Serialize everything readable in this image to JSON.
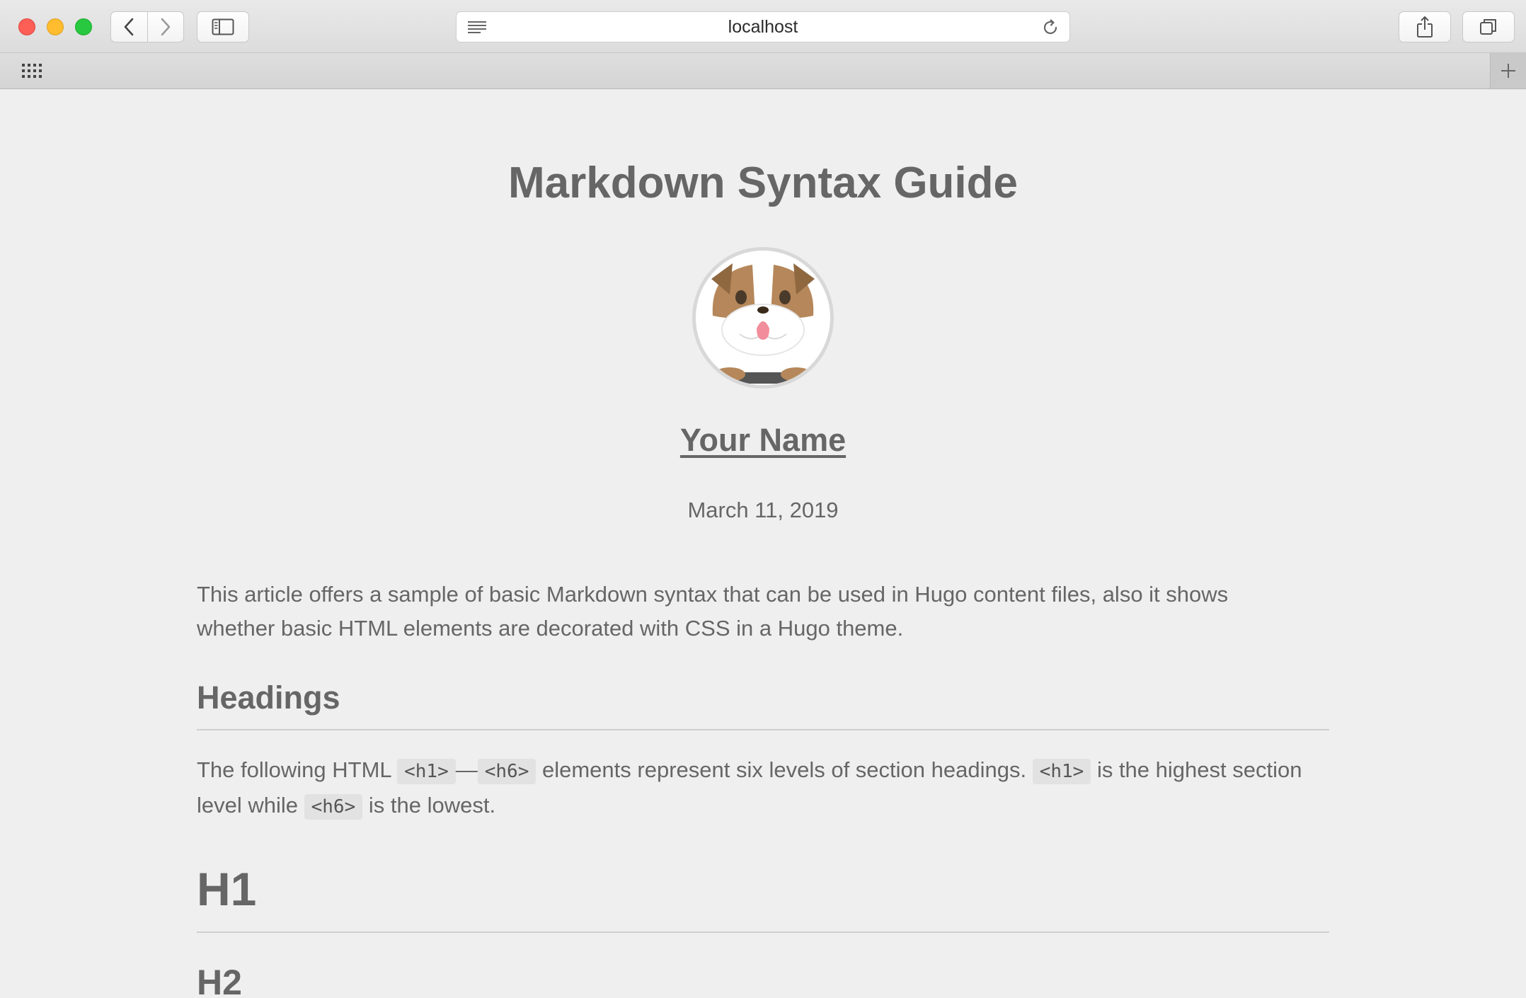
{
  "browser": {
    "url": "localhost",
    "buttons": {
      "back": "back",
      "forward": "forward",
      "sidebar": "sidebar",
      "share": "share",
      "tabs": "tabs",
      "new_tab": "new-tab"
    }
  },
  "article": {
    "title": "Markdown Syntax Guide",
    "author": "Your Name",
    "date": "March 11, 2019",
    "intro": "This article offers a sample of basic Markdown syntax that can be used in Hugo content files, also it shows whether basic HTML elements are decorated with CSS in a Hugo theme.",
    "headings_section": {
      "title": "Headings",
      "text_1": "The following HTML ",
      "code_1": "<h1>",
      "dash": "—",
      "code_2": "<h6>",
      "text_2": " elements represent six levels of section headings. ",
      "code_3": "<h1>",
      "text_3": " is the highest section level while ",
      "code_4": "<h6>",
      "text_4": " is the lowest."
    },
    "h1_demo": "H1",
    "h2_demo": "H2"
  }
}
